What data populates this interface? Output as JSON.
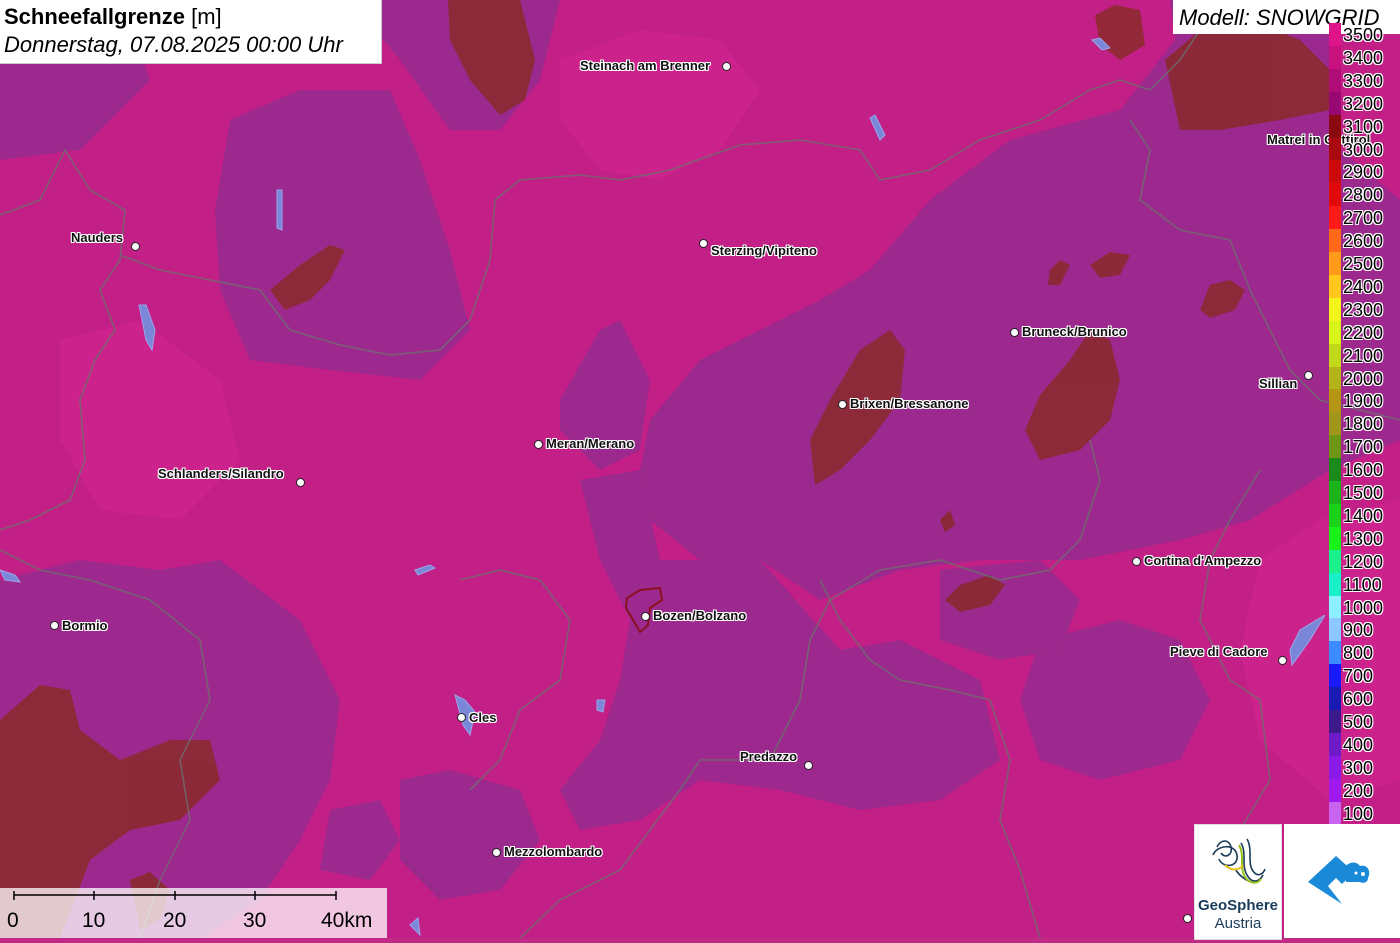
{
  "header": {
    "title_bold": "Schneefallgrenze",
    "title_unit": "[m]",
    "datetime": "Donnerstag, 07.08.2025 00:00 Uhr",
    "model": "Modell: SNOWGRID"
  },
  "cities": [
    {
      "id": "steinach",
      "name": "Steinach am Brenner"
    },
    {
      "id": "nauders",
      "name": "Nauders"
    },
    {
      "id": "sterzing",
      "name": "Sterzing/Vipiteno"
    },
    {
      "id": "matrei",
      "name": "Matrei in Osttirol"
    },
    {
      "id": "bruneck",
      "name": "Bruneck/Brunico"
    },
    {
      "id": "sillian",
      "name": "Sillian"
    },
    {
      "id": "brixen",
      "name": "Brixen/Bressanone"
    },
    {
      "id": "meran",
      "name": "Meran/Merano"
    },
    {
      "id": "schlanders",
      "name": "Schlanders/Silandro"
    },
    {
      "id": "cortina",
      "name": "Cortina d'Ampezzo"
    },
    {
      "id": "bormio",
      "name": "Bormio"
    },
    {
      "id": "bozen",
      "name": "Bozen/Bolzano"
    },
    {
      "id": "pieve",
      "name": "Pieve di Cadore"
    },
    {
      "id": "cles",
      "name": "Cles"
    },
    {
      "id": "predazzo",
      "name": "Predazzo"
    },
    {
      "id": "mezzolombardo",
      "name": "Mezzolombardo"
    }
  ],
  "legend": [
    {
      "label": "3500",
      "color": "#e0148a"
    },
    {
      "label": "3400",
      "color": "#c8107e"
    },
    {
      "label": "3300",
      "color": "#b00c78"
    },
    {
      "label": "3200",
      "color": "#980872"
    },
    {
      "label": "3100",
      "color": "#8a0a10"
    },
    {
      "label": "3000",
      "color": "#a80a10"
    },
    {
      "label": "2900",
      "color": "#cc0a0a"
    },
    {
      "label": "2800",
      "color": "#e00a0a"
    },
    {
      "label": "2700",
      "color": "#ff1a1a"
    },
    {
      "label": "2600",
      "color": "#ff6a1a"
    },
    {
      "label": "2500",
      "color": "#ff9a1a"
    },
    {
      "label": "2400",
      "color": "#ffc81a"
    },
    {
      "label": "2300",
      "color": "#f4f41a"
    },
    {
      "label": "2200",
      "color": "#d8f41a"
    },
    {
      "label": "2100",
      "color": "#c4d81a"
    },
    {
      "label": "2000",
      "color": "#b4b41a"
    },
    {
      "label": "1900",
      "color": "#b49614"
    },
    {
      "label": "1800",
      "color": "#a0961a"
    },
    {
      "label": "1700",
      "color": "#6e9614"
    },
    {
      "label": "1600",
      "color": "#1a8a1a"
    },
    {
      "label": "1500",
      "color": "#1ab41a"
    },
    {
      "label": "1400",
      "color": "#1ad21a"
    },
    {
      "label": "1300",
      "color": "#1af01a"
    },
    {
      "label": "1200",
      "color": "#1af08c"
    },
    {
      "label": "1100",
      "color": "#1af0c8"
    },
    {
      "label": "1000",
      "color": "#8cf0ff"
    },
    {
      "label": "900",
      "color": "#8cc8ff"
    },
    {
      "label": "800",
      "color": "#3c8cff"
    },
    {
      "label": "700",
      "color": "#1a1aff"
    },
    {
      "label": "600",
      "color": "#1a1ab4"
    },
    {
      "label": "500",
      "color": "#3c1a8c"
    },
    {
      "label": "400",
      "color": "#6e1ac8"
    },
    {
      "label": "300",
      "color": "#8c1ae6"
    },
    {
      "label": "200",
      "color": "#a01af0"
    },
    {
      "label": "100",
      "color": "#c864f0"
    }
  ],
  "scale_bar": {
    "labels": [
      "0",
      "10",
      "20",
      "30",
      "40km"
    ]
  },
  "logos": {
    "geosphere_line1": "GeoSphere",
    "geosphere_line2": "Austria"
  }
}
